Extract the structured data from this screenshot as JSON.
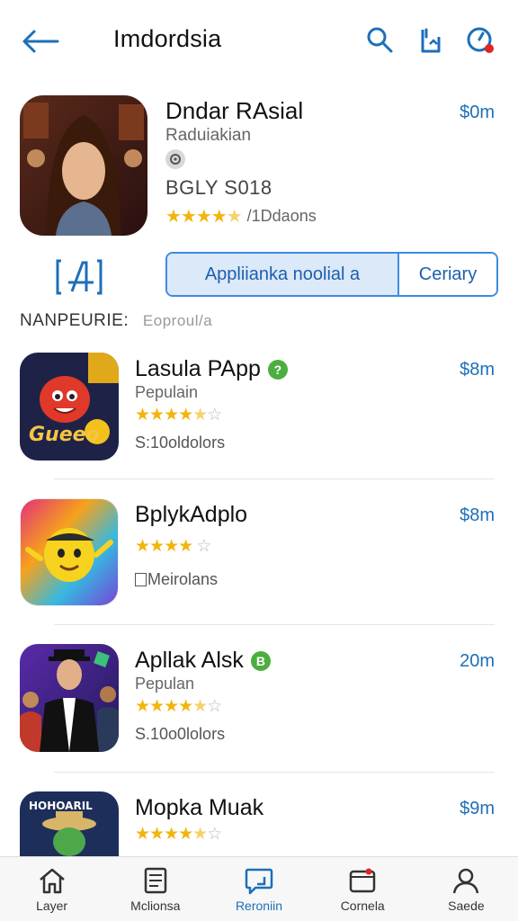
{
  "header": {
    "title": "Imdordsia"
  },
  "featured": {
    "name": "Dndar RAsial",
    "subtitle": "Raduiakian",
    "meta": "BGLY S018",
    "rating_text": "/1Ddaons",
    "rating": 4.5,
    "price": "$0m"
  },
  "actions": {
    "primary_label": "Appliianka noolial a",
    "secondary_label": "Ceriary"
  },
  "section": {
    "label": "NANPEURIE:",
    "sub": "Eoproul/a"
  },
  "apps": [
    {
      "name": "Lasula PApp",
      "verified_mark": "?",
      "subtitle": "Pepulain",
      "rating": 4.5,
      "meta": "S:10oldolors",
      "price": "$8m",
      "art_text": "Gueeo"
    },
    {
      "name": "BplykAdplo",
      "verified_mark": "",
      "subtitle": "",
      "rating": 4,
      "meta": "Meirolans",
      "price": "$8m",
      "art_text": ""
    },
    {
      "name": "Apllak Alsk",
      "verified_mark": "B",
      "subtitle": "Pepulan",
      "rating": 4.5,
      "meta": "S.10o0lolors",
      "price": "20m",
      "art_text": ""
    },
    {
      "name": "Mopka Muak",
      "verified_mark": "",
      "subtitle": "",
      "rating": 4.5,
      "meta": "",
      "price": "$9m",
      "art_text": "HOHOARIL"
    }
  ],
  "tabs": [
    {
      "label": "Layer",
      "icon": "home-icon"
    },
    {
      "label": "Mclionsa",
      "icon": "document-icon"
    },
    {
      "label": "Reroniin",
      "icon": "chat-icon"
    },
    {
      "label": "Cornela",
      "icon": "calendar-icon"
    },
    {
      "label": "Saede",
      "icon": "user-icon"
    }
  ],
  "colors": {
    "accent": "#1d6fb8",
    "star": "#f2b40d",
    "verified": "#4cae3f"
  }
}
